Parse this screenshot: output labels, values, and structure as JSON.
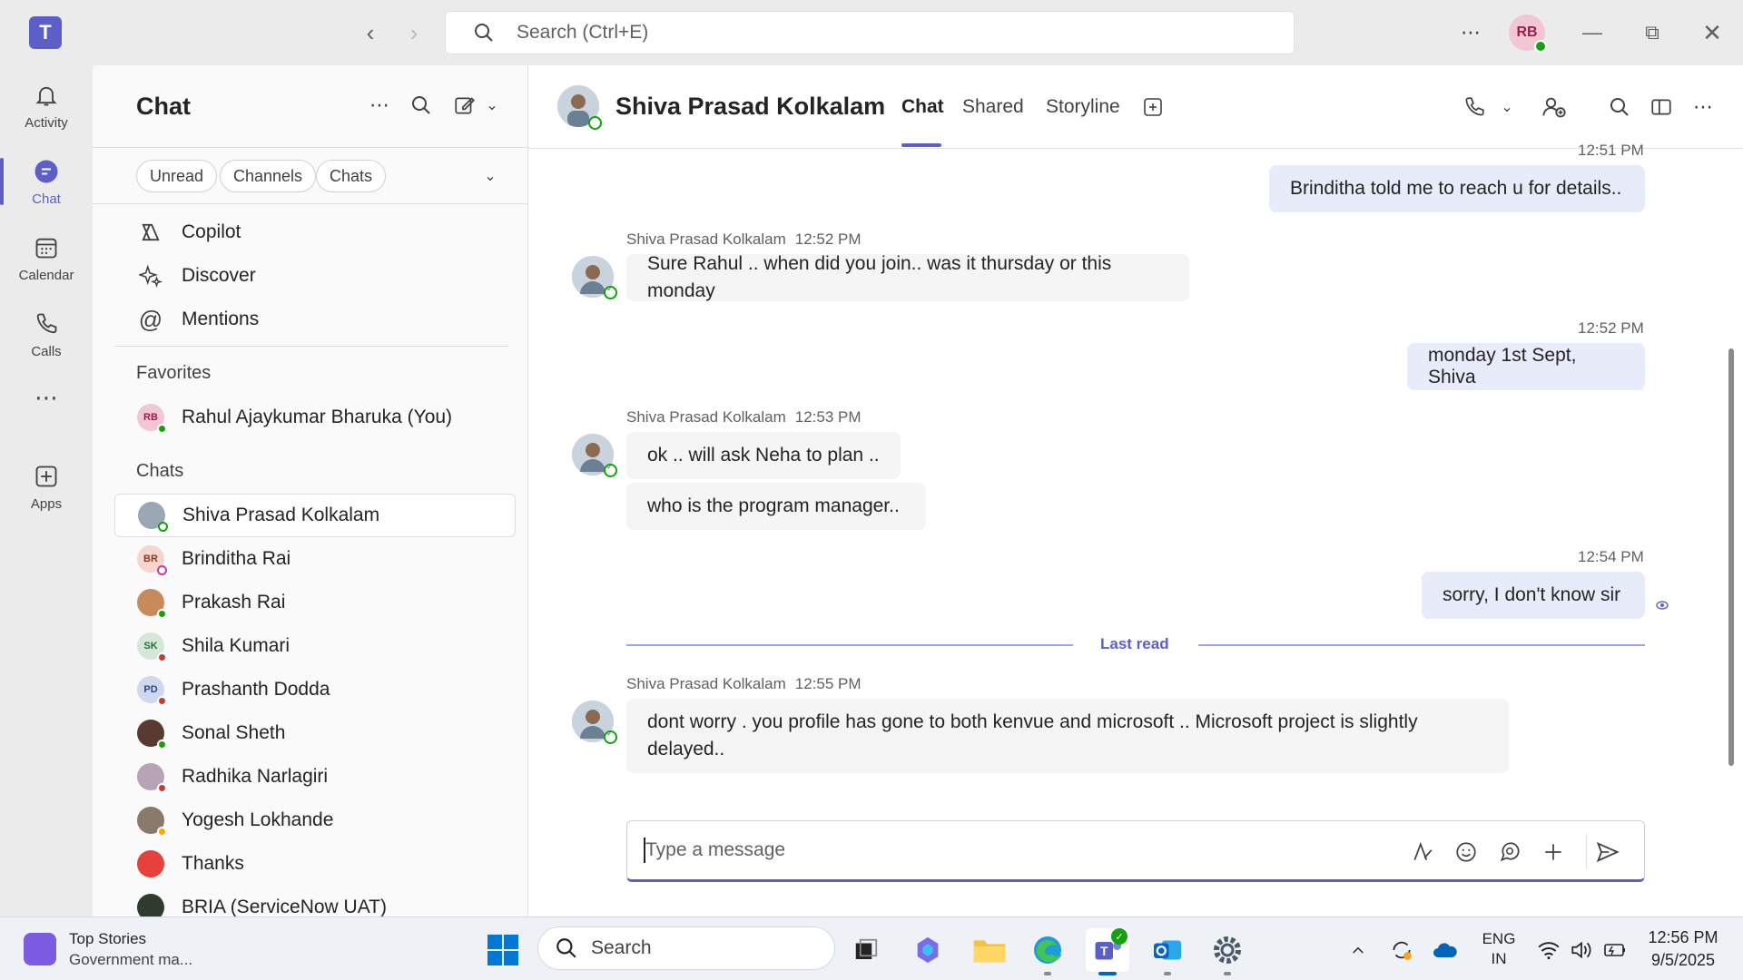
{
  "window": {
    "search_placeholder": "Search (Ctrl+E)",
    "user_initials": "RB"
  },
  "rail": {
    "items": [
      {
        "label": "Activity",
        "icon": "bell-icon"
      },
      {
        "label": "Chat",
        "icon": "chat-icon"
      },
      {
        "label": "Calendar",
        "icon": "calendar-icon"
      },
      {
        "label": "Calls",
        "icon": "phone-icon"
      },
      {
        "label": "Apps",
        "icon": "add-app-icon"
      }
    ]
  },
  "chatlist": {
    "title": "Chat",
    "filters": [
      "Unread",
      "Channels",
      "Chats"
    ],
    "quick": [
      "Copilot",
      "Discover",
      "Mentions"
    ],
    "favorites_label": "Favorites",
    "favorites": [
      {
        "name": "Rahul Ajaykumar Bharuka (You)",
        "initials": "RB"
      }
    ],
    "chats_label": "Chats",
    "chats": [
      {
        "name": "Shiva Prasad Kolkalam",
        "initials": ""
      },
      {
        "name": "Brinditha Rai",
        "initials": "BR"
      },
      {
        "name": "Prakash Rai",
        "initials": ""
      },
      {
        "name": "Shila Kumari",
        "initials": "SK"
      },
      {
        "name": "Prashanth Dodda",
        "initials": "PD"
      },
      {
        "name": "Sonal Sheth",
        "initials": ""
      },
      {
        "name": "Radhika Narlagiri",
        "initials": ""
      },
      {
        "name": "Yogesh Lokhande",
        "initials": ""
      },
      {
        "name": "Thanks",
        "initials": ""
      },
      {
        "name": "BRIA (ServiceNow UAT)",
        "initials": ""
      }
    ]
  },
  "conversation": {
    "contact_name": "Shiva Prasad Kolkalam",
    "tabs": [
      "Chat",
      "Shared",
      "Storyline"
    ],
    "messages": [
      {
        "time": "12:51 PM",
        "text": "Brinditha told me to reach u for details.."
      },
      {
        "sender": "Shiva Prasad Kolkalam",
        "time": "12:52 PM",
        "text": "Sure Rahul .. when did you join.. was it thursday or this monday"
      },
      {
        "time": "12:52 PM",
        "text": "monday 1st Sept, Shiva"
      },
      {
        "sender": "Shiva Prasad Kolkalam",
        "time": "12:53 PM",
        "text": "ok .. will ask Neha to plan .."
      },
      {
        "text": "who is the program manager.."
      },
      {
        "time": "12:54 PM",
        "text": "sorry, I don't know sir"
      },
      {
        "sender": "Shiva Prasad Kolkalam",
        "time": "12:55 PM",
        "text_line1": "dont worry . you profile has gone to both kenvue and microsoft .. Microsoft project is slightly",
        "text_line2": "delayed.."
      }
    ],
    "last_read_label": "Last read",
    "composer_placeholder": "Type a message"
  },
  "taskbar": {
    "news_title": "Top Stories",
    "news_sub": "Government ma...",
    "search_label": "Search",
    "lang_line1": "ENG",
    "lang_line2": "IN",
    "time": "12:56 PM",
    "date": "9/5/2025"
  }
}
